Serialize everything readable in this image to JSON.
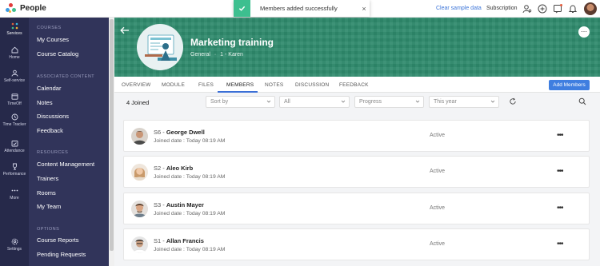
{
  "app": {
    "name": "People"
  },
  "toast": {
    "message": "Members added successfully",
    "close": "×"
  },
  "topbar": {
    "clear_sample": "Clear sample data",
    "subscription": "Subscription"
  },
  "rail": [
    {
      "label": "Services"
    },
    {
      "label": "Home"
    },
    {
      "label": "Self-service"
    },
    {
      "label": "TimeOff"
    },
    {
      "label": "Time Tracker"
    },
    {
      "label": "Attendance"
    },
    {
      "label": "Performance"
    },
    {
      "label": "More"
    },
    {
      "label": "Settings"
    }
  ],
  "sidebar": {
    "courses_head": "COURSES",
    "my_courses": "My Courses",
    "course_catalog": "Course Catalog",
    "assoc_head": "ASSOCIATED CONTENT",
    "calendar": "Calendar",
    "notes": "Notes",
    "discussions": "Discussions",
    "feedback": "Feedback",
    "resources_head": "RESOURCES",
    "content_management": "Content Management",
    "trainers": "Trainers",
    "rooms": "Rooms",
    "my_team": "My Team",
    "options_head": "OPTIONS",
    "course_reports": "Course Reports",
    "pending_requests": "Pending Requests"
  },
  "course": {
    "title": "Marketing training",
    "category": "General",
    "separator": "·",
    "owner": "1 - Karen"
  },
  "tabs": [
    "OVERVIEW",
    "MODULE",
    "FILES",
    "MEMBERS",
    "NOTES",
    "DISCUSSION",
    "FEEDBACK"
  ],
  "add_members": "Add Members",
  "filters": {
    "joined": "4 Joined",
    "sort_by": "Sort by",
    "all": "All",
    "progress": "Progress",
    "period": "This year"
  },
  "members": [
    {
      "id": "S6 - ",
      "name": "George Dwell",
      "joined": "Joined date : Today 08:19 AM",
      "status": "Active"
    },
    {
      "id": "S2 - ",
      "name": "Aleo Kirb",
      "joined": "Joined date : Today 08:19 AM",
      "status": "Active"
    },
    {
      "id": "S3 - ",
      "name": "Austin Mayer",
      "joined": "Joined date : Today 08:19 AM",
      "status": "Active"
    },
    {
      "id": "S1 - ",
      "name": "Allan Francis",
      "joined": "Joined date : Today 08:19 AM",
      "status": "Active"
    }
  ],
  "colors": {
    "accent": "#3f7ee0",
    "banner": "#2e8a6c",
    "rail": "#26294a",
    "subnav": "#31345a",
    "toast_ok": "#3dbf8f"
  },
  "icons": [
    "check-icon",
    "user-search-icon",
    "plus-circle-icon",
    "feed-icon",
    "bell-icon",
    "back-arrow-icon",
    "chevron-down-icon",
    "refresh-icon",
    "search-icon",
    "more-icon"
  ]
}
